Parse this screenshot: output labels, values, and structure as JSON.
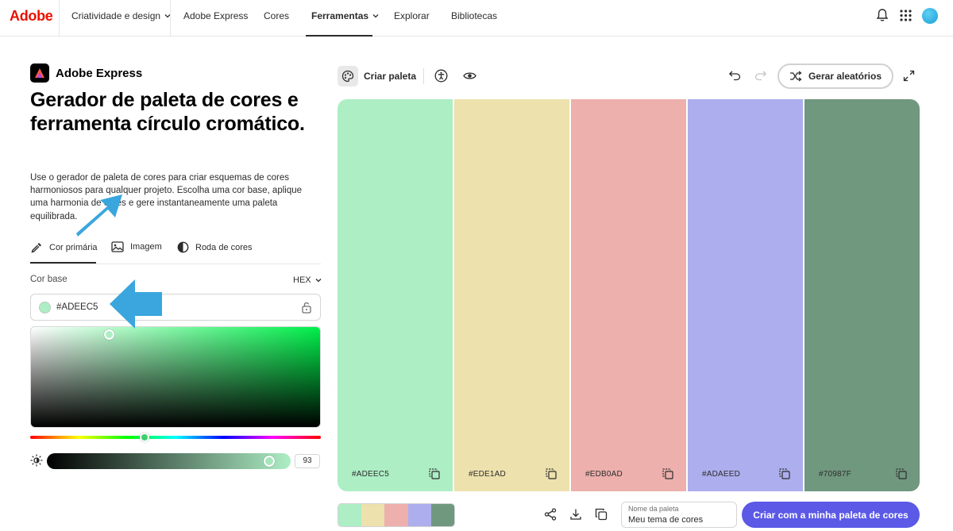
{
  "nav": {
    "logo": "Adobe",
    "items": [
      {
        "label": "Criatividade e design"
      },
      {
        "label": "Adobe Express"
      },
      {
        "label": "Cores"
      },
      {
        "label": "Ferramentas"
      },
      {
        "label": "Explorar"
      },
      {
        "label": "Bibliotecas"
      }
    ],
    "active": "Ferramentas",
    "icons": [
      "bell-icon",
      "apps-grid-icon",
      "avatar"
    ]
  },
  "left": {
    "brand": "Adobe Express",
    "headline": "Gerador de paleta de cores e ferramenta círculo cromático.",
    "intro": "Use o gerador de paleta de cores para criar esquemas de cores harmoniosos para qualquer projeto. Escolha uma cor base, aplique uma harmonia de cores e gere instantaneamente uma paleta equilibrada.",
    "tabs": [
      {
        "label": "Cor primária",
        "icon": "eyedropper-icon"
      },
      {
        "label": "Imagem",
        "icon": "image-icon"
      },
      {
        "label": "Roda de cores",
        "icon": "color-wheel-icon"
      }
    ],
    "base_label": "Cor base",
    "format": "HEX",
    "hex_value": "#ADEEC5",
    "base_color": "#ADEEC5",
    "brightness": "93"
  },
  "toolbar": {
    "create_palette": "Criar paleta",
    "random_button": "Gerar aleatórios"
  },
  "palette": {
    "swatches": [
      {
        "hex": "#ADEEC5",
        "color": "#ADEEC5"
      },
      {
        "hex": "#EDE1AD",
        "color": "#EDE1AD"
      },
      {
        "hex": "#EDB0AD",
        "color": "#EDB0AD"
      },
      {
        "hex": "#ADAEED",
        "color": "#ADAEED"
      },
      {
        "hex": "#70987F",
        "color": "#70987F"
      }
    ]
  },
  "bottom": {
    "name_label": "Nome da paleta",
    "name_value": "Meu tema de cores",
    "cta": "Criar com a minha paleta de cores"
  },
  "colors": {
    "accent": "#5B59E6",
    "logo_red": "#EB1000",
    "callout_arrow": "#3AA6DD"
  }
}
